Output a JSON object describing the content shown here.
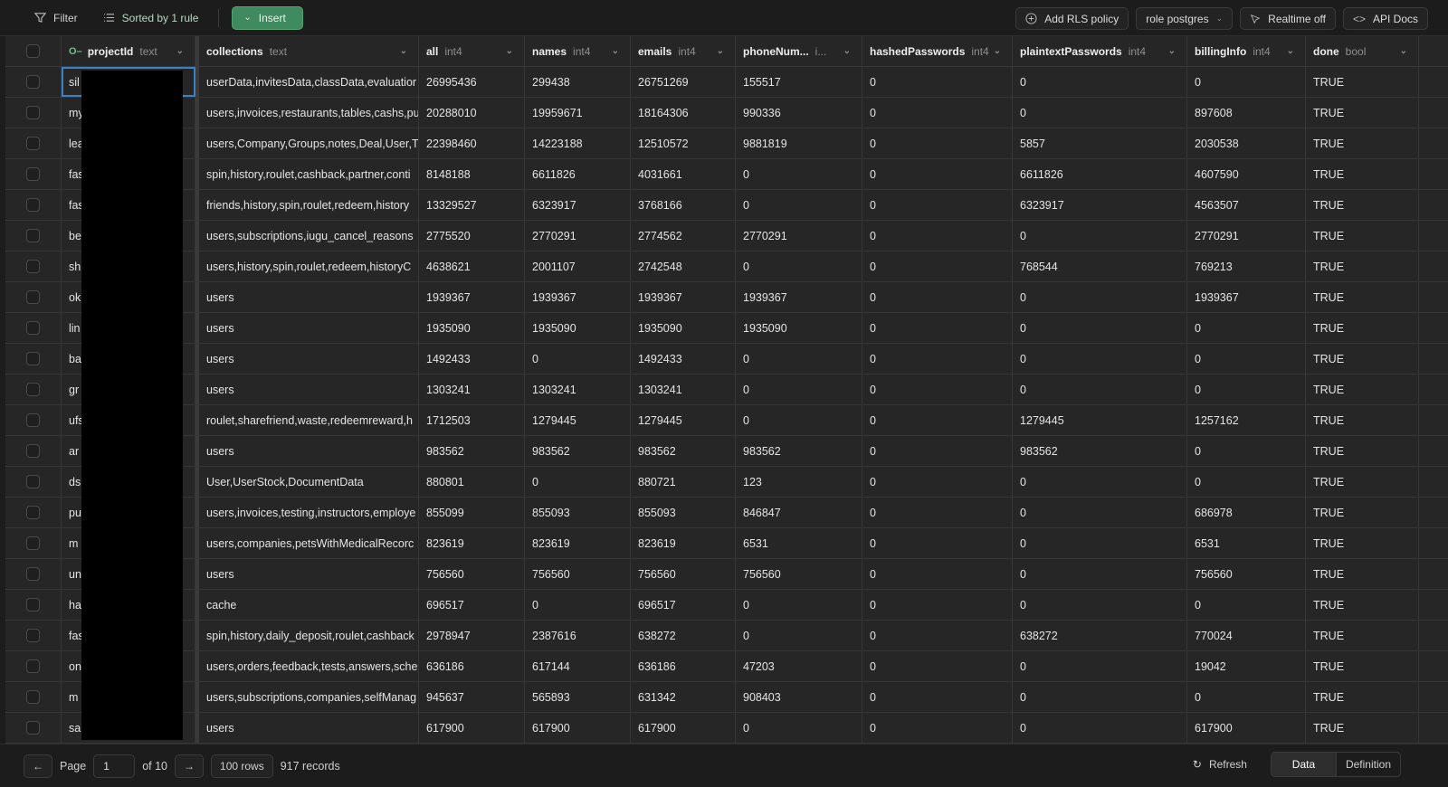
{
  "toolbar": {
    "filter": "Filter",
    "sort": "Sorted by 1 rule",
    "insert": "Insert",
    "add_rls": "Add RLS policy",
    "role": "role postgres",
    "realtime": "Realtime off",
    "api_docs": "API Docs"
  },
  "columns": [
    {
      "name": "projectId",
      "type": "text",
      "primary_key": true
    },
    {
      "name": "collections",
      "type": "text"
    },
    {
      "name": "all",
      "type": "int4"
    },
    {
      "name": "names",
      "type": "int4"
    },
    {
      "name": "emails",
      "type": "int4"
    },
    {
      "name": "phoneNum...",
      "type": "i..."
    },
    {
      "name": "hashedPasswords",
      "type": "int4"
    },
    {
      "name": "plaintextPasswords",
      "type": "int4"
    },
    {
      "name": "billingInfo",
      "type": "int4"
    },
    {
      "name": "done",
      "type": "bool"
    }
  ],
  "rows": [
    [
      "sil",
      "userData,invitesData,classData,evaluatior",
      "26995436",
      "299438",
      "26751269",
      "155517",
      "0",
      "0",
      "0",
      "TRUE"
    ],
    [
      "my",
      "users,invoices,restaurants,tables,cashs,pu",
      "20288010",
      "19959671",
      "18164306",
      "990336",
      "0",
      "0",
      "897608",
      "TRUE"
    ],
    [
      "lea",
      "users,Company,Groups,notes,Deal,User,T",
      "22398460",
      "14223188",
      "12510572",
      "9881819",
      "0",
      "5857",
      "2030538",
      "TRUE"
    ],
    [
      "fas",
      "spin,history,roulet,cashback,partner,conti",
      "8148188",
      "6611826",
      "4031661",
      "0",
      "0",
      "6611826",
      "4607590",
      "TRUE"
    ],
    [
      "fas",
      "friends,history,spin,roulet,redeem,history",
      "13329527",
      "6323917",
      "3768166",
      "0",
      "0",
      "6323917",
      "4563507",
      "TRUE"
    ],
    [
      "be",
      "users,subscriptions,iugu_cancel_reasons",
      "2775520",
      "2770291",
      "2774562",
      "2770291",
      "0",
      "0",
      "2770291",
      "TRUE"
    ],
    [
      "sh",
      "users,history,spin,roulet,redeem,historyC",
      "4638621",
      "2001107",
      "2742548",
      "0",
      "0",
      "768544",
      "769213",
      "TRUE"
    ],
    [
      "ok",
      "users",
      "1939367",
      "1939367",
      "1939367",
      "1939367",
      "0",
      "0",
      "1939367",
      "TRUE"
    ],
    [
      "lin",
      "users",
      "1935090",
      "1935090",
      "1935090",
      "1935090",
      "0",
      "0",
      "0",
      "TRUE"
    ],
    [
      "ba",
      "users",
      "1492433",
      "0",
      "1492433",
      "0",
      "0",
      "0",
      "0",
      "TRUE"
    ],
    [
      "gr",
      "users",
      "1303241",
      "1303241",
      "1303241",
      "0",
      "0",
      "0",
      "0",
      "TRUE"
    ],
    [
      "ufs",
      "roulet,sharefriend,waste,redeemreward,h",
      "1712503",
      "1279445",
      "1279445",
      "0",
      "0",
      "1279445",
      "1257162",
      "TRUE"
    ],
    [
      "ar",
      "users",
      "983562",
      "983562",
      "983562",
      "983562",
      "0",
      "983562",
      "0",
      "TRUE"
    ],
    [
      "ds",
      "User,UserStock,DocumentData",
      "880801",
      "0",
      "880721",
      "123",
      "0",
      "0",
      "0",
      "TRUE"
    ],
    [
      "pu",
      "users,invoices,testing,instructors,employe",
      "855099",
      "855093",
      "855093",
      "846847",
      "0",
      "0",
      "686978",
      "TRUE"
    ],
    [
      "m",
      "users,companies,petsWithMedicalRecorc",
      "823619",
      "823619",
      "823619",
      "6531",
      "0",
      "0",
      "6531",
      "TRUE"
    ],
    [
      "un",
      "users",
      "756560",
      "756560",
      "756560",
      "756560",
      "0",
      "0",
      "756560",
      "TRUE"
    ],
    [
      "ha",
      "cache",
      "696517",
      "0",
      "696517",
      "0",
      "0",
      "0",
      "0",
      "TRUE"
    ],
    [
      "fas",
      "spin,history,daily_deposit,roulet,cashback",
      "2978947",
      "2387616",
      "638272",
      "0",
      "0",
      "638272",
      "770024",
      "TRUE"
    ],
    [
      "on",
      "users,orders,feedback,tests,answers,sche",
      "636186",
      "617144",
      "636186",
      "47203",
      "0",
      "0",
      "19042",
      "TRUE"
    ],
    [
      "m",
      "users,subscriptions,companies,selfManag",
      "945637",
      "565893",
      "631342",
      "908403",
      "0",
      "0",
      "0",
      "TRUE"
    ],
    [
      "sa",
      "users",
      "617900",
      "617900",
      "617900",
      "0",
      "0",
      "0",
      "617900",
      "TRUE"
    ]
  ],
  "footer": {
    "page_label": "Page",
    "page_value": "1",
    "of_pages": "of 10",
    "rows_per_page": "100 rows",
    "records": "917 records",
    "refresh": "Refresh",
    "tab_data": "Data",
    "tab_definition": "Definition",
    "active_tab": "Data"
  },
  "colors": {
    "accent": "#3f8a5e",
    "selection": "#3b82c4",
    "background": "#1c1c1c"
  }
}
